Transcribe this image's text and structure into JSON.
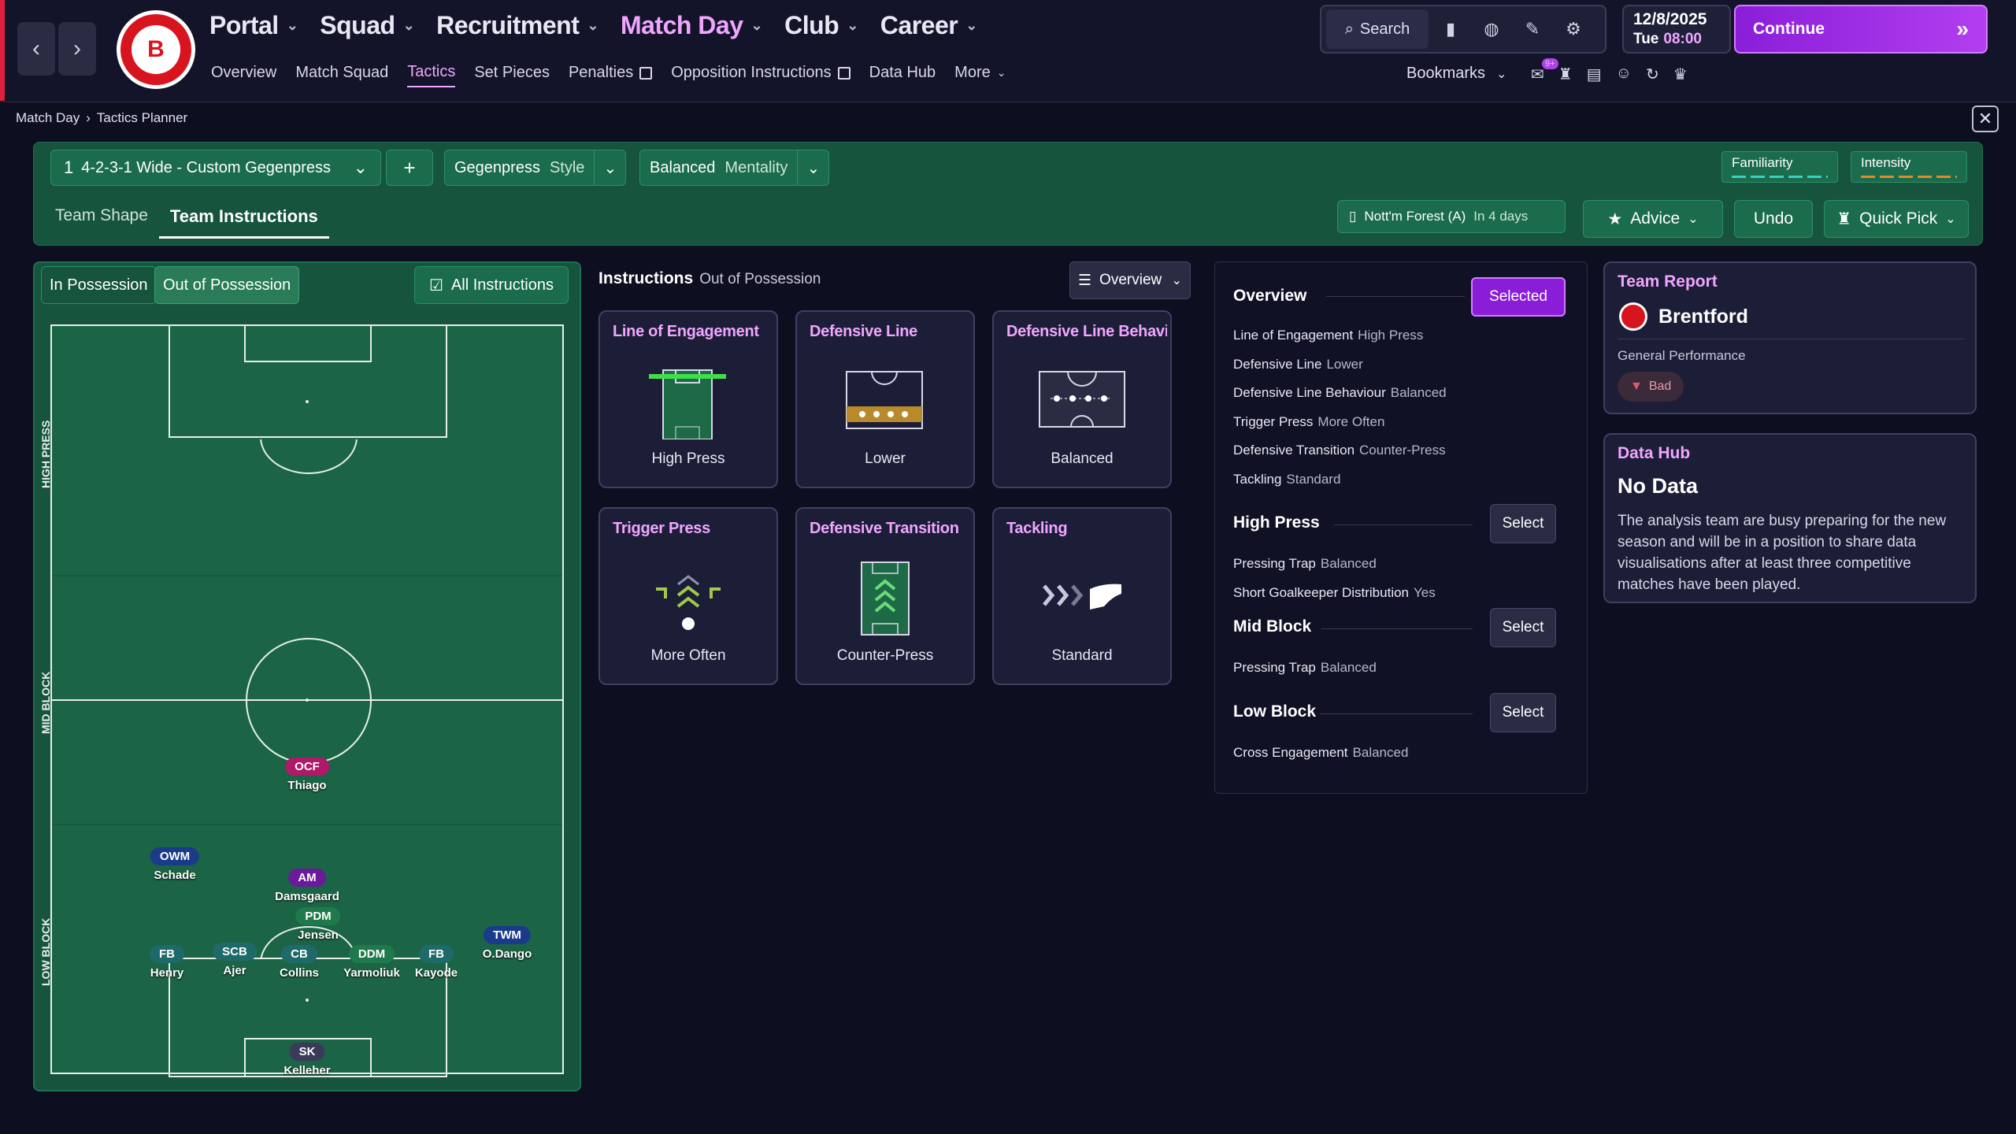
{
  "nav": {
    "main": [
      {
        "label": "Portal",
        "active": false
      },
      {
        "label": "Squad",
        "active": false
      },
      {
        "label": "Recruitment",
        "active": false
      },
      {
        "label": "Match Day",
        "active": true
      },
      {
        "label": "Club",
        "active": false
      },
      {
        "label": "Career",
        "active": false
      }
    ],
    "sub": [
      {
        "label": "Overview"
      },
      {
        "label": "Match Squad"
      },
      {
        "label": "Tactics",
        "active": true
      },
      {
        "label": "Set Pieces"
      },
      {
        "label": "Penalties",
        "ext": true
      },
      {
        "label": "Opposition Instructions",
        "ext": true
      },
      {
        "label": "Data Hub"
      },
      {
        "label": "More",
        "chev": true
      }
    ],
    "search_label": "Search",
    "date": "12/8/2025",
    "day": "Tue",
    "time": "08:00",
    "continue_label": "Continue",
    "bookmarks_label": "Bookmarks",
    "notif_count": "9+"
  },
  "breadcrumb": {
    "parent": "Match Day",
    "current": "Tactics Planner"
  },
  "tactic": {
    "slot": "1",
    "formation": "4-2-3-1 Wide - Custom Gegenpress",
    "style_value": "Gegenpress",
    "style_label": "Style",
    "mentality_value": "Balanced",
    "mentality_label": "Mentality",
    "familiarity_label": "Familiarity",
    "intensity_label": "Intensity"
  },
  "tabs": [
    "Team Shape",
    "Team Instructions"
  ],
  "next_match": {
    "opponent": "Nott'm Forest (A)",
    "when": "In 4 days"
  },
  "buttons": {
    "advice": "Advice",
    "undo": "Undo",
    "quick_pick": "Quick Pick"
  },
  "phase_tabs": {
    "in_possession": "In Possession",
    "out_possession": "Out of Possession",
    "all_instructions": "All Instructions"
  },
  "zones": {
    "high": "HIGH PRESS",
    "mid": "MID BLOCK",
    "low": "LOW BLOCK"
  },
  "players": [
    {
      "role": "OCF",
      "name": "Thiago",
      "color": "#b0186a"
    },
    {
      "role": "OWM",
      "name": "Schade",
      "color": "#1a3a8a"
    },
    {
      "role": "AM",
      "name": "Damsgaard",
      "color": "#6a1a9a"
    },
    {
      "role": "PDM",
      "name": "Jensen",
      "color": "#1e7a4a"
    },
    {
      "role": "TWM",
      "name": "O.Dango",
      "color": "#1a3a8a"
    },
    {
      "role": "FB",
      "name": "Henry",
      "color": "#1e6a6a"
    },
    {
      "role": "SCB",
      "name": "Ajer",
      "color": "#1e6a6a"
    },
    {
      "role": "CB",
      "name": "Collins",
      "color": "#1e6a6a"
    },
    {
      "role": "DDM",
      "name": "Yarmoliuk",
      "color": "#1e7a4a"
    },
    {
      "role": "FB",
      "name": "Kayode",
      "color": "#1e6a6a"
    },
    {
      "role": "SK",
      "name": "Kelleher",
      "color": "#3a3a5a"
    }
  ],
  "instructions": {
    "header": "Instructions",
    "phase": "Out of Possession",
    "view": "Overview",
    "cards": [
      {
        "title": "Line of Engagement",
        "value": "High Press"
      },
      {
        "title": "Defensive Line",
        "value": "Lower"
      },
      {
        "title": "Defensive Line Behaviour",
        "value": "Balanced"
      },
      {
        "title": "Trigger Press",
        "value": "More Often"
      },
      {
        "title": "Defensive Transition",
        "value": "Counter-Press"
      },
      {
        "title": "Tackling",
        "value": "Standard"
      }
    ]
  },
  "overview": {
    "title": "Overview",
    "selected_label": "Selected",
    "rows": [
      {
        "k": "Line of Engagement",
        "v": "High Press"
      },
      {
        "k": "Defensive Line",
        "v": "Lower"
      },
      {
        "k": "Defensive Line Behaviour",
        "v": "Balanced"
      },
      {
        "k": "Trigger Press",
        "v": "More Often"
      },
      {
        "k": "Defensive Transition",
        "v": "Counter-Press"
      },
      {
        "k": "Tackling",
        "v": "Standard"
      }
    ],
    "select_label": "Select",
    "high_press": {
      "title": "High Press",
      "rows": [
        {
          "k": "Pressing Trap",
          "v": "Balanced"
        },
        {
          "k": "Short Goalkeeper Distribution",
          "v": "Yes"
        }
      ]
    },
    "mid_block": {
      "title": "Mid Block",
      "rows": [
        {
          "k": "Pressing Trap",
          "v": "Balanced"
        }
      ]
    },
    "low_block": {
      "title": "Low Block",
      "rows": [
        {
          "k": "Cross Engagement",
          "v": "Balanced"
        }
      ]
    }
  },
  "team_report": {
    "title": "Team Report",
    "team": "Brentford",
    "perf_label": "General Performance",
    "perf_value": "Bad"
  },
  "data_hub": {
    "title": "Data Hub",
    "heading": "No Data",
    "body": "The analysis team are busy preparing for the new season and will be in a position to share data visualisations after at least three competitive matches have been played."
  },
  "colors": {
    "accent": "#f0a6ff",
    "purple": "#b23ef0",
    "green_panel": "#16543e",
    "bad": "#e05a6a"
  }
}
